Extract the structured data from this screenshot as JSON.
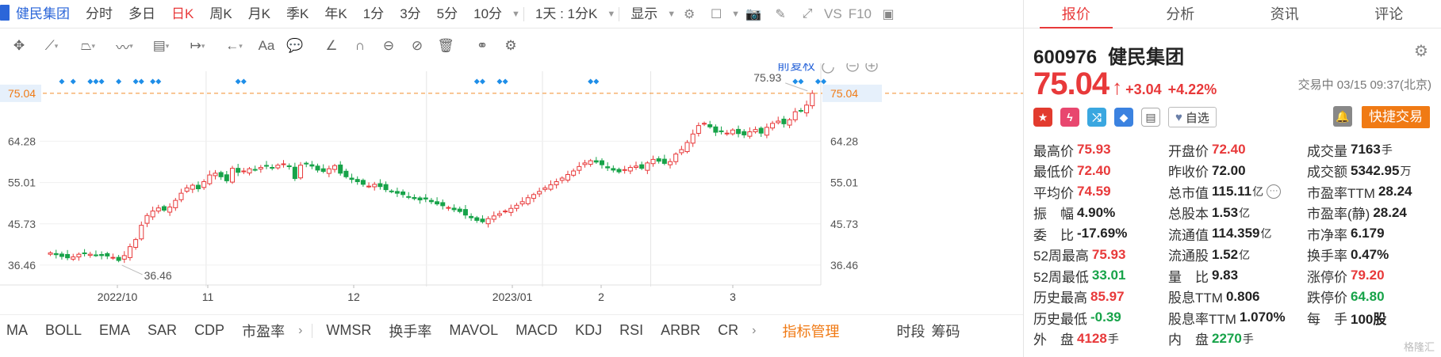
{
  "topbar": {
    "stock_name": "健民集团",
    "periods": [
      "分时",
      "多日",
      "日K",
      "周K",
      "月K",
      "季K",
      "年K",
      "1分",
      "3分",
      "5分",
      "10分"
    ],
    "active_period": "日K",
    "interval_select": "1天 : 1分K",
    "display_label": "显示",
    "vs_label": "VS",
    "f10_label": "F10"
  },
  "chart": {
    "restore_label": "前复权",
    "price_line_label": "75.04",
    "high_annotation": "75.93",
    "low_annotation": "36.46",
    "y_ticks": [
      "64.28",
      "55.01",
      "45.73",
      "36.46"
    ],
    "x_ticks": [
      "2022/10",
      "11",
      "12",
      "2023/01",
      "2",
      "3"
    ]
  },
  "chart_data": {
    "type": "candlestick",
    "title": "",
    "ylim": [
      32,
      80
    ],
    "y_ticks": [
      64.28,
      55.01,
      45.73,
      36.46
    ],
    "x_ticks": [
      "2022/10",
      "11",
      "12",
      "2023/01",
      "2",
      "3"
    ],
    "last_price": 75.04,
    "period_high": 75.93,
    "period_low": 36.46,
    "close_series": [
      39.2,
      38.8,
      38.4,
      38.1,
      38.3,
      38.9,
      39.1,
      38.9,
      38.7,
      38.6,
      38.5,
      38.2,
      37.5,
      38.6,
      40.6,
      42.2,
      45.4,
      47.6,
      48.6,
      49.3,
      48.8,
      49.5,
      51.0,
      52.6,
      53.8,
      54.4,
      53.6,
      55.2,
      56.7,
      57.1,
      56.3,
      55.4,
      58.2,
      57.3,
      57.6,
      58.1,
      57.9,
      58.4,
      58.7,
      58.3,
      58.9,
      59.2,
      58.6,
      55.9,
      58.9,
      59.3,
      58.7,
      57.8,
      57.5,
      58.1,
      58.8,
      57.1,
      56.3,
      55.7,
      55.2,
      54.6,
      54.2,
      54.6,
      54.1,
      53.4,
      53.0,
      52.6,
      52.3,
      51.8,
      51.4,
      51.1,
      51.3,
      50.7,
      50.2,
      49.8,
      49.4,
      48.9,
      48.5,
      47.7,
      47.1,
      46.5,
      46.2,
      46.9,
      47.5,
      48.0,
      48.6,
      49.2,
      49.9,
      50.7,
      51.6,
      52.3,
      53.0,
      53.8,
      54.5,
      55.2,
      56.0,
      56.8,
      57.6,
      58.6,
      59.4,
      59.9,
      59.6,
      59.0,
      58.3,
      57.8,
      57.4,
      57.9,
      58.4,
      58.7,
      58.2,
      59.4,
      60.2,
      59.8,
      59.3,
      59.7,
      61.4,
      62.4,
      64.0,
      65.9,
      67.8,
      68.3,
      67.5,
      66.3,
      66.5,
      66.1,
      66.8,
      66.0,
      65.7,
      66.4,
      66.9,
      66.1,
      67.4,
      68.3,
      68.8,
      68.2,
      69.1,
      70.9,
      71.1,
      72.4,
      75.04
    ],
    "markers_days": [
      2,
      4,
      7,
      8,
      9,
      12,
      15,
      16,
      18,
      19,
      33,
      34,
      75,
      76,
      79,
      80,
      95,
      96,
      131,
      132,
      135,
      136
    ]
  },
  "toolbar": {
    "tools": [
      "move-icon",
      "line-icon",
      "polygon-icon",
      "wave-icon",
      "fib-icon",
      "measure-icon",
      "arrow-icon",
      "text-icon",
      "comment-icon",
      "angle-icon",
      "magnet-icon",
      "eye-lock-icon",
      "hide-icon",
      "trash-icon",
      "link-icon",
      "gear-icon"
    ]
  },
  "indicators": {
    "group1": [
      "MA",
      "BOLL",
      "EMA",
      "SAR",
      "CDP",
      "市盈率"
    ],
    "group2": [
      "WMSR",
      "换手率",
      "MAVOL",
      "MACD",
      "KDJ",
      "RSI",
      "ARBR",
      "CR"
    ],
    "manage_label": "指标管理",
    "period_label": "时段",
    "chip_label": "筹码"
  },
  "tabs": [
    "报价",
    "分析",
    "资讯",
    "评论"
  ],
  "quote": {
    "code": "600976",
    "name": "健民集团",
    "price": "75.04",
    "change": "+3.04",
    "pct": "+4.22%",
    "status": "交易中 03/15 09:37(北京)",
    "watch_label": "自选",
    "trade_label": "快捷交易"
  },
  "stats": [
    [
      [
        "最高价",
        "75.93",
        "red",
        ""
      ],
      [
        "开盘价",
        "72.40",
        "red",
        ""
      ],
      [
        "成交量",
        "7163",
        "",
        "手"
      ]
    ],
    [
      [
        "最低价",
        "72.40",
        "red",
        ""
      ],
      [
        "昨收价",
        "72.00",
        "",
        ""
      ],
      [
        "成交额",
        "5342.95",
        "",
        "万"
      ]
    ],
    [
      [
        "平均价",
        "74.59",
        "red",
        ""
      ],
      [
        "总市值",
        "115.11",
        "",
        "亿"
      ],
      [
        "市盈率TTM",
        "28.24",
        "",
        ""
      ]
    ],
    [
      [
        "振　幅",
        "4.90%",
        "",
        ""
      ],
      [
        "总股本",
        "1.53",
        "",
        "亿"
      ],
      [
        "市盈率(静)",
        "28.24",
        "",
        ""
      ]
    ],
    [
      [
        "委　比",
        "-17.69%",
        "",
        ""
      ],
      [
        "流通值",
        "114.359",
        "",
        "亿"
      ],
      [
        "市净率",
        "6.179",
        "",
        ""
      ]
    ],
    [
      [
        "52周最高",
        "75.93",
        "red",
        ""
      ],
      [
        "流通股",
        "1.52",
        "",
        "亿"
      ],
      [
        "换手率",
        "0.47%",
        "",
        ""
      ]
    ],
    [
      [
        "52周最低",
        "33.01",
        "green",
        ""
      ],
      [
        "量　比",
        "9.83",
        "",
        ""
      ],
      [
        "涨停价",
        "79.20",
        "red",
        ""
      ]
    ],
    [
      [
        "历史最高",
        "85.97",
        "red",
        ""
      ],
      [
        "股息TTM",
        "0.806",
        "",
        ""
      ],
      [
        "跌停价",
        "64.80",
        "green",
        ""
      ]
    ],
    [
      [
        "历史最低",
        "-0.39",
        "green",
        ""
      ],
      [
        "股息率TTM",
        "1.070%",
        "",
        ""
      ],
      [
        "每　手",
        "100股",
        "",
        ""
      ]
    ],
    [
      [
        "外　盘",
        "4128",
        "red",
        "手"
      ],
      [
        "内　盘",
        "2270",
        "green",
        "手"
      ],
      [
        "",
        "",
        "",
        ""
      ]
    ]
  ],
  "watermark": "格隆汇"
}
